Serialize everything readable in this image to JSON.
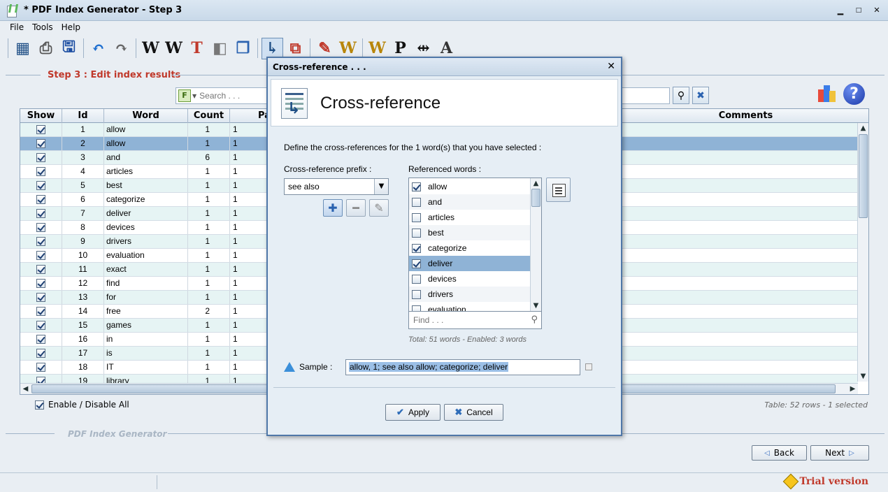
{
  "window": {
    "title": "* PDF Index Generator - Step 3"
  },
  "menu": [
    "File",
    "Tools",
    "Help"
  ],
  "toolbar": {
    "items": [
      {
        "name": "table-icon",
        "glyph": "▦",
        "color": "#1f4f86"
      },
      {
        "name": "printer-icon",
        "glyph": "⎙",
        "color": "#555"
      },
      {
        "name": "save-icon",
        "glyph": "🖫",
        "color": "#1d4fa3"
      },
      {
        "name": "undo-icon",
        "glyph": "↶",
        "color": "#1f6fd0"
      },
      {
        "name": "redo-icon",
        "glyph": "↷",
        "color": "#666"
      },
      {
        "name": "add-word-icon",
        "glyph": "W",
        "color": "#111"
      },
      {
        "name": "edit-word-icon",
        "glyph": "W",
        "color": "#111"
      },
      {
        "name": "text-case-icon",
        "glyph": "T",
        "color": "#c0392b"
      },
      {
        "name": "merge-icon",
        "glyph": "◧",
        "color": "#777"
      },
      {
        "name": "window-icon",
        "glyph": "❐",
        "color": "#2a62b0"
      },
      {
        "name": "cross-reference-icon",
        "glyph": "↳",
        "color": "#1f4f86",
        "active": true
      },
      {
        "name": "add-page-icon",
        "glyph": "⧉",
        "color": "#c0392b"
      },
      {
        "name": "edit-page-icon",
        "glyph": "✎",
        "color": "#c0392b"
      },
      {
        "name": "refresh-word-icon",
        "glyph": "W",
        "color": "#b8860b"
      },
      {
        "name": "sync-word-icon",
        "glyph": "W",
        "color": "#b8860b"
      },
      {
        "name": "page-number-icon",
        "glyph": "P",
        "color": "#111"
      },
      {
        "name": "separator-icon",
        "glyph": "⇹",
        "color": "#111"
      },
      {
        "name": "font-icon",
        "glyph": "A",
        "color": "#333"
      }
    ]
  },
  "step": {
    "title": "Step 3 : Edit index results"
  },
  "search": {
    "placeholder": "Search . . .",
    "filter_letter": "F"
  },
  "table": {
    "columns": [
      "Show",
      "Id",
      "Word",
      "Count",
      "Pa",
      "Comments"
    ],
    "rows": [
      {
        "show": true,
        "id": "1",
        "word": "allow",
        "count": "1",
        "page": "1"
      },
      {
        "show": true,
        "id": "2",
        "word": "allow",
        "count": "1",
        "page": "1",
        "selected": true
      },
      {
        "show": true,
        "id": "3",
        "word": "and",
        "count": "6",
        "page": "1"
      },
      {
        "show": true,
        "id": "4",
        "word": "articles",
        "count": "1",
        "page": "1"
      },
      {
        "show": true,
        "id": "5",
        "word": "best",
        "count": "1",
        "page": "1"
      },
      {
        "show": true,
        "id": "6",
        "word": "categorize",
        "count": "1",
        "page": "1"
      },
      {
        "show": true,
        "id": "7",
        "word": "deliver",
        "count": "1",
        "page": "1"
      },
      {
        "show": true,
        "id": "8",
        "word": "devices",
        "count": "1",
        "page": "1"
      },
      {
        "show": true,
        "id": "9",
        "word": "drivers",
        "count": "1",
        "page": "1"
      },
      {
        "show": true,
        "id": "10",
        "word": "evaluation",
        "count": "1",
        "page": "1"
      },
      {
        "show": true,
        "id": "11",
        "word": "exact",
        "count": "1",
        "page": "1"
      },
      {
        "show": true,
        "id": "12",
        "word": "find",
        "count": "1",
        "page": "1"
      },
      {
        "show": true,
        "id": "13",
        "word": "for",
        "count": "1",
        "page": "1"
      },
      {
        "show": true,
        "id": "14",
        "word": "free",
        "count": "2",
        "page": "1"
      },
      {
        "show": true,
        "id": "15",
        "word": "games",
        "count": "1",
        "page": "1"
      },
      {
        "show": true,
        "id": "16",
        "word": "in",
        "count": "1",
        "page": "1"
      },
      {
        "show": true,
        "id": "17",
        "word": "is",
        "count": "1",
        "page": "1"
      },
      {
        "show": true,
        "id": "18",
        "word": "IT",
        "count": "1",
        "page": "1"
      },
      {
        "show": true,
        "id": "19",
        "word": "library",
        "count": "1",
        "page": "1"
      }
    ],
    "status": "Table: 52 rows - 1 selected"
  },
  "enable_all": {
    "label": "Enable / Disable All",
    "checked": true
  },
  "footer": {
    "label": "PDF Index Generator",
    "back": "Back",
    "next": "Next"
  },
  "status": {
    "trial": "Trial version"
  },
  "dialog": {
    "title": "Cross-reference . . .",
    "heading": "Cross-reference",
    "description": "Define the cross-references for the 1 word(s) that you have selected :",
    "prefix_label": "Cross-reference prefix :",
    "prefix_value": "see also",
    "referenced_label": "Referenced words :",
    "words": [
      {
        "word": "allow",
        "checked": true
      },
      {
        "word": "and",
        "checked": false
      },
      {
        "word": "articles",
        "checked": false
      },
      {
        "word": "best",
        "checked": false
      },
      {
        "word": "categorize",
        "checked": true
      },
      {
        "word": "deliver",
        "checked": true,
        "selected": true
      },
      {
        "word": "devices",
        "checked": false
      },
      {
        "word": "drivers",
        "checked": false
      },
      {
        "word": "evaluation",
        "checked": false
      }
    ],
    "find_placeholder": "Find . . .",
    "total": "Total: 51 words - Enabled: 3 words",
    "sample_label": "Sample :",
    "sample_value": "allow, 1; see also allow; categorize; deliver",
    "apply": "Apply",
    "cancel": "Cancel"
  }
}
